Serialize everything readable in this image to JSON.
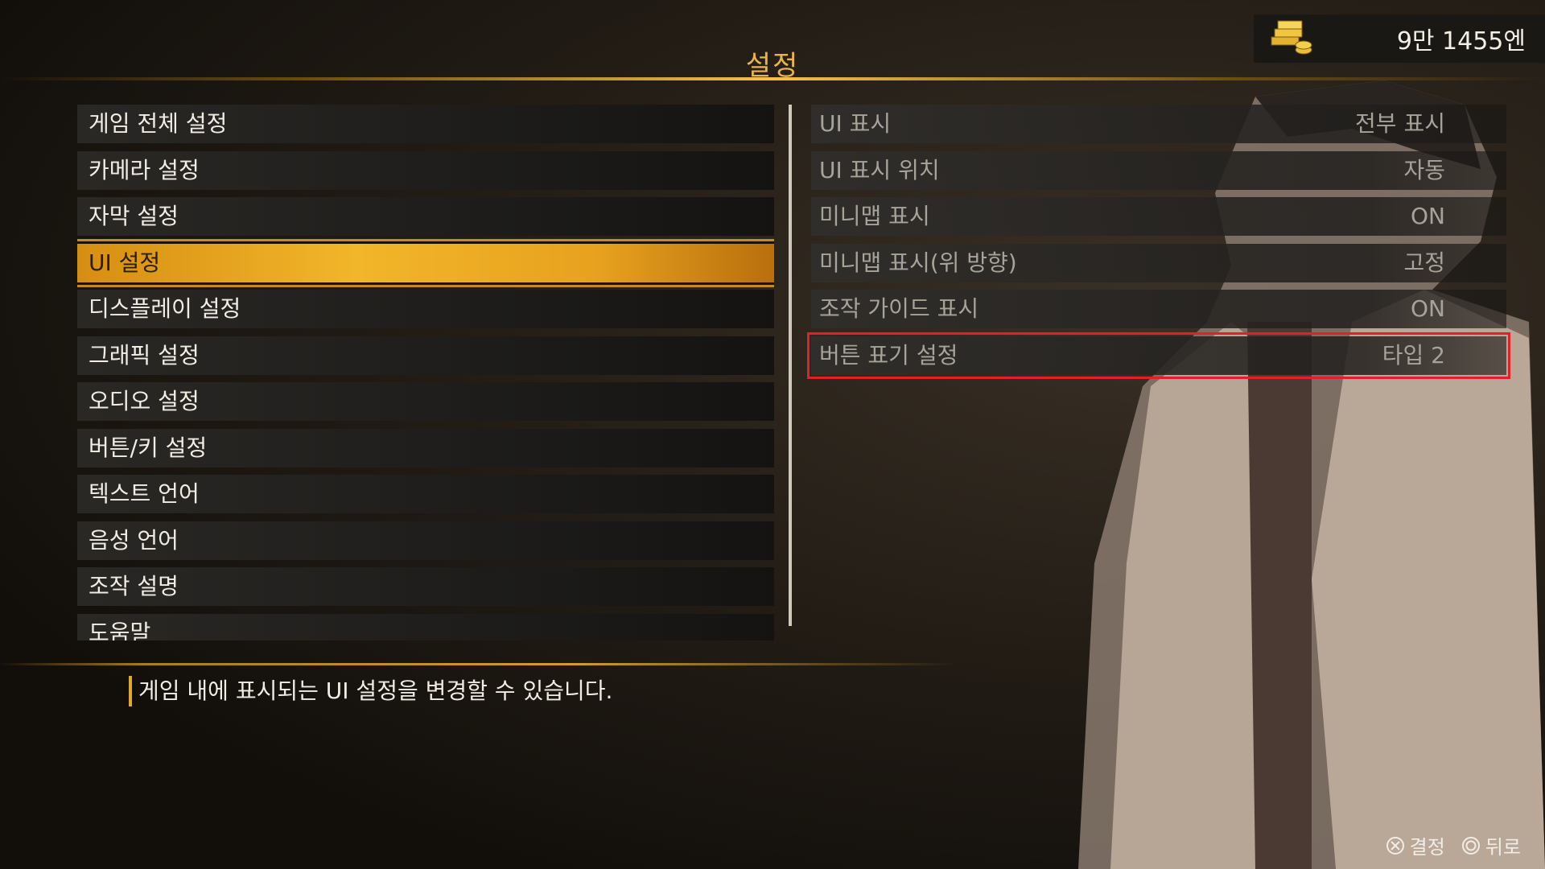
{
  "header": {
    "title": "설정"
  },
  "money": {
    "amount": "9만 1455엔",
    "icon": "yen-money-stack-icon"
  },
  "menu": {
    "items": [
      {
        "label": "게임 전체 설정",
        "selected": false
      },
      {
        "label": "카메라 설정",
        "selected": false
      },
      {
        "label": "자막 설정",
        "selected": false
      },
      {
        "label": "UI 설정",
        "selected": true
      },
      {
        "label": "디스플레이 설정",
        "selected": false
      },
      {
        "label": "그래픽 설정",
        "selected": false
      },
      {
        "label": "오디오 설정",
        "selected": false
      },
      {
        "label": "버튼/키 설정",
        "selected": false
      },
      {
        "label": "텍스트 언어",
        "selected": false
      },
      {
        "label": "음성 언어",
        "selected": false
      },
      {
        "label": "조작 설명",
        "selected": false
      },
      {
        "label": "도움말",
        "selected": false
      }
    ]
  },
  "options": {
    "rows": [
      {
        "label": "UI 표시",
        "value": "전부 표시"
      },
      {
        "label": "UI 표시 위치",
        "value": "자동"
      },
      {
        "label": "미니맵 표시",
        "value": "ON"
      },
      {
        "label": "미니맵 표시(위 방향)",
        "value": "고정"
      },
      {
        "label": "조작 가이드 표시",
        "value": "ON"
      },
      {
        "label": "버튼 표기 설정",
        "value": "타입 2",
        "highlighted": true
      }
    ]
  },
  "description": "게임 내에 표시되는 UI 설정을 변경할 수 있습니다.",
  "footer": {
    "confirm": {
      "icon": "cross-button-icon",
      "label": "결정"
    },
    "back": {
      "icon": "circle-button-icon",
      "label": "뒤로"
    }
  },
  "colors": {
    "accent": "#f2b62a",
    "highlight_box": "#e0202a"
  }
}
